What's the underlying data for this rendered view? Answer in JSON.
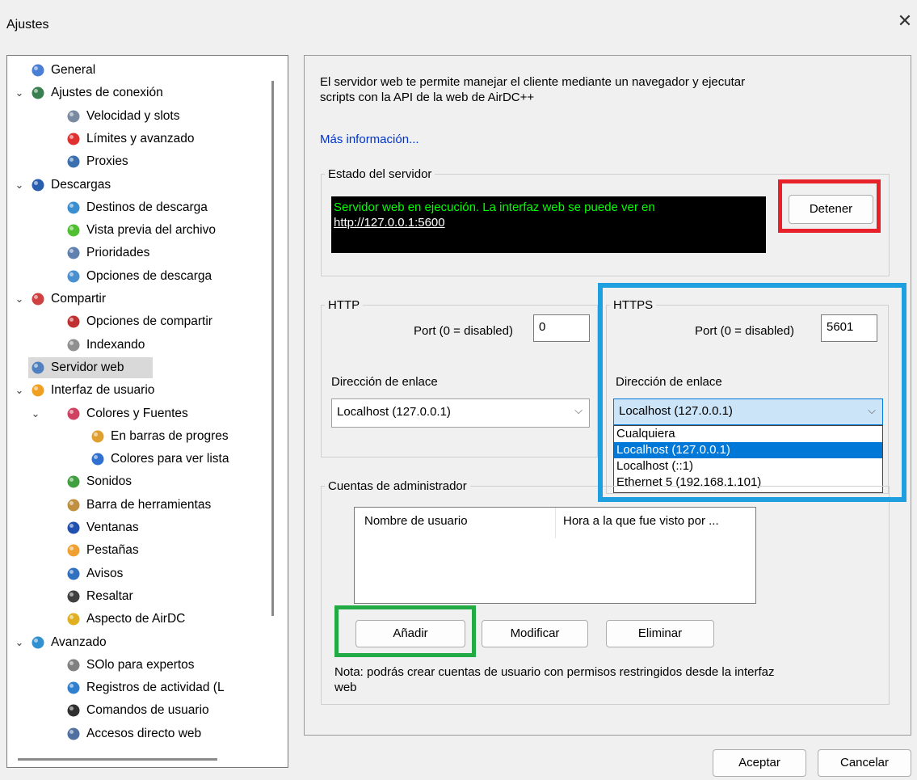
{
  "window": {
    "title": "Ajustes",
    "close_glyph": "✕"
  },
  "tree": [
    {
      "label": "General",
      "icon": "user-icon",
      "color": "#4a7fd6",
      "level": 0,
      "chev": ""
    },
    {
      "label": "Ajustes de conexión",
      "icon": "connection-icon",
      "color": "#3a7f4f",
      "level": 0,
      "chev": "⌄"
    },
    {
      "label": "Velocidad y slots",
      "icon": "hourglass-icon",
      "color": "#7a8aa0",
      "level": 1,
      "chev": ""
    },
    {
      "label": "Límites y avanzado",
      "icon": "limit-sign-icon",
      "color": "#e03030",
      "level": 1,
      "chev": ""
    },
    {
      "label": "Proxies",
      "icon": "proxy-icon",
      "color": "#3a6fb0",
      "level": 1,
      "chev": ""
    },
    {
      "label": "Descargas",
      "icon": "download-globe-icon",
      "color": "#2a5fb0",
      "level": 0,
      "chev": "⌄"
    },
    {
      "label": "Destinos de descarga",
      "icon": "folder-icon",
      "color": "#3a8fd0",
      "level": 1,
      "chev": ""
    },
    {
      "label": "Vista previa del archivo",
      "icon": "play-icon",
      "color": "#50c030",
      "level": 1,
      "chev": ""
    },
    {
      "label": "Prioridades",
      "icon": "priority-icon",
      "color": "#6080b0",
      "level": 1,
      "chev": ""
    },
    {
      "label": "Opciones de descarga",
      "icon": "download-options-icon",
      "color": "#4a90d0",
      "level": 1,
      "chev": ""
    },
    {
      "label": "Compartir",
      "icon": "share-icon",
      "color": "#d04040",
      "level": 0,
      "chev": "⌄"
    },
    {
      "label": "Opciones de compartir",
      "icon": "share-options-icon",
      "color": "#c03030",
      "level": 1,
      "chev": ""
    },
    {
      "label": "Indexando",
      "icon": "index-icon",
      "color": "#909090",
      "level": 1,
      "chev": ""
    },
    {
      "label": "Servidor web",
      "icon": "web-server-icon",
      "color": "#5080c0",
      "level": 0,
      "chev": "",
      "selected": true
    },
    {
      "label": "Interfaz de usuario",
      "icon": "palette-icon",
      "color": "#f0a020",
      "level": 0,
      "chev": "⌄"
    },
    {
      "label": "Colores y Fuentes",
      "icon": "colors-icon",
      "color": "#d04060",
      "level": 1,
      "chev": "⌄"
    },
    {
      "label": "En barras de progres",
      "icon": "progress-colors-icon",
      "color": "#e0a030",
      "level": 2,
      "chev": ""
    },
    {
      "label": "Colores para ver lista",
      "icon": "list-colors-icon",
      "color": "#3070d0",
      "level": 2,
      "chev": ""
    },
    {
      "label": "Sonidos",
      "icon": "sound-icon",
      "color": "#40a040",
      "level": 1,
      "chev": ""
    },
    {
      "label": "Barra de herramientas",
      "icon": "toolbar-icon",
      "color": "#c09040",
      "level": 1,
      "chev": ""
    },
    {
      "label": "Ventanas",
      "icon": "window-icon",
      "color": "#2050b0",
      "level": 1,
      "chev": ""
    },
    {
      "label": "Pestañas",
      "icon": "tabs-icon",
      "color": "#f0a030",
      "level": 1,
      "chev": ""
    },
    {
      "label": "Avisos",
      "icon": "notice-icon",
      "color": "#3070c0",
      "level": 1,
      "chev": ""
    },
    {
      "label": "Resaltar",
      "icon": "highlight-icon",
      "color": "#404040",
      "level": 1,
      "chev": ""
    },
    {
      "label": "Aspecto de AirDC",
      "icon": "appearance-icon",
      "color": "#e0b020",
      "level": 1,
      "chev": ""
    },
    {
      "label": "Avanzado",
      "icon": "advanced-icon",
      "color": "#3090d0",
      "level": 0,
      "chev": "⌄"
    },
    {
      "label": "SOlo para expertos",
      "icon": "gears-icon",
      "color": "#808080",
      "level": 1,
      "chev": ""
    },
    {
      "label": "Registros de actividad (L",
      "icon": "log-icon",
      "color": "#3080d0",
      "level": 1,
      "chev": ""
    },
    {
      "label": "Comandos de usuario",
      "icon": "user-command-icon",
      "color": "#303030",
      "level": 1,
      "chev": ""
    },
    {
      "label": "Accesos directo web",
      "icon": "web-shortcut-icon",
      "color": "#5070a0",
      "level": 1,
      "chev": ""
    }
  ],
  "main": {
    "description_line1": "El servidor web te permite manejar el cliente mediante un navegador y ejecutar",
    "description_line2": "scripts con la API de la web de AirDC++",
    "more_info_link": "Más información...",
    "server_status": {
      "legend": "Estado del servidor",
      "message": "Servidor web en ejecución. La interfaz web se puede ver en",
      "url": "http://127.0.0.1:5600",
      "stop_button": "Detener"
    },
    "http": {
      "legend": "HTTP",
      "port_label": "Port (0 = disabled)",
      "port_value": "0",
      "bind_label": "Dirección de enlace",
      "bind_value": "Localhost (127.0.0.1)"
    },
    "https": {
      "legend": "HTTPS",
      "port_label": "Port (0 = disabled)",
      "port_value": "5601",
      "bind_label": "Dirección de enlace",
      "bind_value": "Localhost (127.0.0.1)",
      "options": [
        "Cualquiera",
        "Localhost (127.0.0.1)",
        "Localhost (::1)",
        "Ethernet 5 (192.168.1.101)"
      ],
      "selected_option": 1
    },
    "admin": {
      "legend": "Cuentas de administrador",
      "columns": [
        "Nombre de usuario",
        "Hora a la que fue visto por ..."
      ],
      "add_button": "Añadir",
      "edit_button": "Modificar",
      "delete_button": "Eliminar",
      "note_line1": "Nota: podrás crear cuentas de usuario con permisos restringidos desde la interfaz",
      "note_line2": "web"
    }
  },
  "footer": {
    "ok_button": "Aceptar",
    "cancel_button": "Cancelar"
  },
  "highlight_colors": {
    "stop": "#e8202a",
    "https": "#1ea0e0",
    "add": "#22aa44"
  }
}
